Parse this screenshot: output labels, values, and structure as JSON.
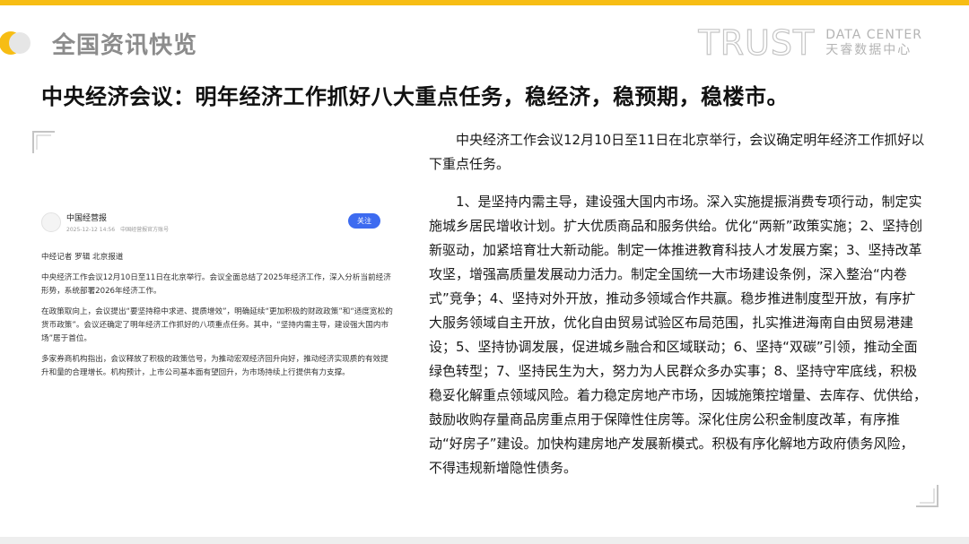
{
  "header": {
    "section_title": "全国资讯快览",
    "brand_main": "TRUST",
    "brand_en": "DATA CENTER",
    "brand_cn": "天睿数据中心"
  },
  "headline": "中央经济会议：明年经济工作抓好八大重点任务，稳经济，稳预期，稳楼市。",
  "screenshot": {
    "source_name": "中国经营报",
    "meta": "2025-12-12 14:56　中国经营报官方账号",
    "follow_label": "关注",
    "byline": "中经记者 罗辑 北京报道",
    "paragraphs": [
      "中央经济工作会议12月10日至11日在北京举行。会议全面总结了2025年经济工作，深入分析当前经济形势，系统部署2026年经济工作。",
      "在政策取向上，会议提出“要坚持稳中求进、提质增效”，明确延续“更加积极的财政政策”和“适度宽松的货币政策”。会议还确定了明年经济工作抓好的八项重点任务。其中，“坚持内需主导，建设强大国内市场”居于首位。",
      "多家券商机构指出，会议释放了积极的政策信号，为推动宏观经济回升向好，推动经济实现质的有效提升和量的合理增长。机构预计，上市公司基本面有望回升，为市场持续上行提供有力支撑。"
    ]
  },
  "article": {
    "intro": "中央经济工作会议12月10日至11日在北京举行，会议确定明年经济工作抓好以下重点任务。",
    "body": "1、是坚持内需主导，建设强大国内市场。深入实施提振消费专项行动，制定实施城乡居民增收计划。扩大优质商品和服务供给。优化“两新”政策实施；2、坚持创新驱动，加紧培育壮大新动能。制定一体推进教育科技人才发展方案；3、坚持改革攻坚，增强高质量发展动力活力。制定全国统一大市场建设条例，深入整治“内卷式”竞争；4、坚持对外开放，推动多领域合作共赢。稳步推进制度型开放，有序扩大服务领域自主开放，优化自由贸易试验区布局范围，扎实推进海南自由贸易港建设；5、坚持协调发展，促进城乡融合和区域联动；6、坚持“双碳”引领，推动全面绿色转型；7、坚持民生为大，努力为人民群众多办实事；8、坚持守牢底线，积极稳妥化解重点领域风险。着力稳定房地产市场，因城施策控增量、去库存、优供给，鼓励收购存量商品房重点用于保障性住房等。深化住房公积金制度改革，有序推动“好房子”建设。加快构建房地产发展新模式。积极有序化解地方政府债务风险，不得违规新增隐性债务。"
  },
  "colors": {
    "accent": "#f7bd14",
    "section_title": "#8c8c8c",
    "follow_button": "#3d6bf0"
  }
}
